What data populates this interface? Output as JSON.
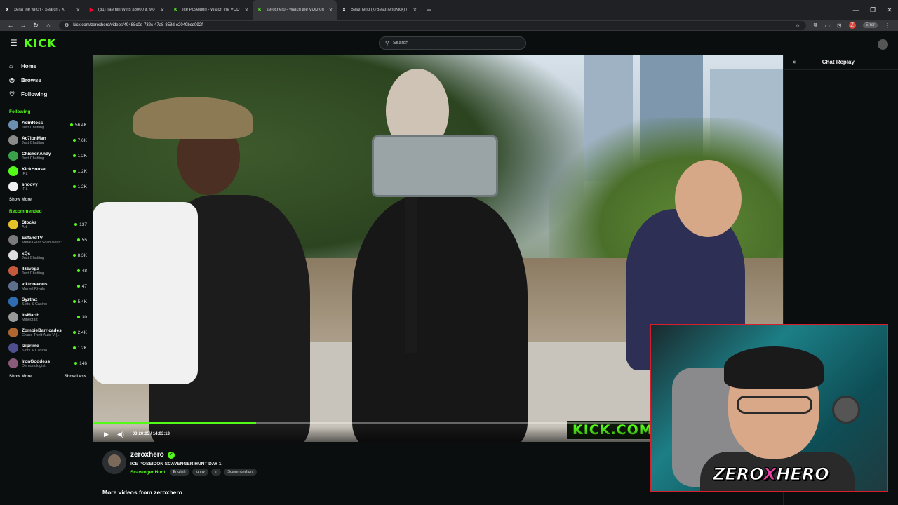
{
  "browser": {
    "tabs": [
      {
        "title": "xena the witch - Search / X",
        "icon": "x-logo-icon",
        "icon_glyph": "X",
        "icon_color": "#ffffff"
      },
      {
        "title": "(31) Taemin Wins $6000 & Mo",
        "icon": "youtube-icon",
        "icon_glyph": "▶",
        "icon_color": "#ff0033"
      },
      {
        "title": "Ice Poseidon - Watch the VOD",
        "icon": "kick-icon",
        "icon_glyph": "K",
        "icon_color": "#53fc18"
      },
      {
        "title": "zeroxhero - Watch the VOD on",
        "icon": "kick-icon",
        "icon_glyph": "K",
        "icon_color": "#53fc18"
      },
      {
        "title": "Bestfriend (@BestfriendKick) /",
        "icon": "x-logo-icon",
        "icon_glyph": "X",
        "icon_color": "#ffffff"
      }
    ],
    "active_tab": 3,
    "url": "kick.com/zeroxhero/videos/49488c0e-732c-47a8-853d-e2049bcd092f",
    "error_label": "Error",
    "profile_initial": "Z"
  },
  "header": {
    "logo": "KICK",
    "search_placeholder": "Search"
  },
  "sidebar": {
    "nav": [
      {
        "label": "Home",
        "icon": "home-icon",
        "glyph": "⌂"
      },
      {
        "label": "Browse",
        "icon": "compass-icon",
        "glyph": "◎"
      },
      {
        "label": "Following",
        "icon": "heart-icon",
        "glyph": "♡"
      }
    ],
    "following_title": "Following",
    "following": [
      {
        "name": "AdinRoss",
        "category": "Just Chatting",
        "viewers": "56.4K",
        "color": "#6b8fb0"
      },
      {
        "name": "Ac7ionMan",
        "category": "Just Chatting",
        "viewers": "7.6K",
        "color": "#8a8a8a"
      },
      {
        "name": "ChickenAndy",
        "category": "Just Chatting",
        "viewers": "1.2K",
        "color": "#3aa14a"
      },
      {
        "name": "KickHouse",
        "category": "IRL",
        "viewers": "1.2K",
        "color": "#53fc18"
      },
      {
        "name": "shoovy",
        "category": "IRL",
        "viewers": "1.2K",
        "color": "#f0f0f0"
      }
    ],
    "following_more": "Show More",
    "recommended_title": "Recommended",
    "recommended": [
      {
        "name": "Stocks",
        "category": "Art",
        "viewers": "137",
        "color": "#e6c229"
      },
      {
        "name": "EsfandTV",
        "category": "Metal Gear Solid Delta:...",
        "viewers": "55",
        "color": "#7a7a7a"
      },
      {
        "name": "xQc",
        "category": "Just Chatting",
        "viewers": "8.3K",
        "color": "#dddddd"
      },
      {
        "name": "Ilzzvega",
        "category": "Just Chatting",
        "viewers": "48",
        "color": "#c45a3b"
      },
      {
        "name": "viktoreeous",
        "category": "Marvel Rivals",
        "viewers": "47",
        "color": "#5d6f8a"
      },
      {
        "name": "Syztmz",
        "category": "Slots & Casino",
        "viewers": "5.4K",
        "color": "#2f6db0"
      },
      {
        "name": "ItsMarth",
        "category": "Minecraft",
        "viewers": "30",
        "color": "#9a9a9a"
      },
      {
        "name": "ZombieBarricades",
        "category": "Grand Theft Auto V (...",
        "viewers": "2.4K",
        "color": "#b0662f"
      },
      {
        "name": "lziprime",
        "category": "Slots & Casino",
        "viewers": "1.2K",
        "color": "#4f4f8f"
      },
      {
        "name": "IronGoddess",
        "category": "Demonologist",
        "viewers": "146",
        "color": "#8a5a7a"
      }
    ],
    "show_more": "Show More",
    "show_less": "Show Less"
  },
  "player": {
    "watermark": "KICK.COM/",
    "time": "03:20:05 / 14:03:13",
    "progress": 0.237
  },
  "chat": {
    "title": "Chat Replay"
  },
  "video_info": {
    "channel": "zeroxhero",
    "title": "ICE POSEIDON  SCAVENGER HUNT DAY 1",
    "category": "Scavenger Hunt",
    "tags": [
      "English",
      "funny",
      "irl",
      "Scavengerhunt"
    ],
    "more_videos": "More videos from zeroxhero"
  },
  "facecam": {
    "brand_left": "ZERO",
    "brand_x": "X",
    "brand_right": "HERO"
  }
}
